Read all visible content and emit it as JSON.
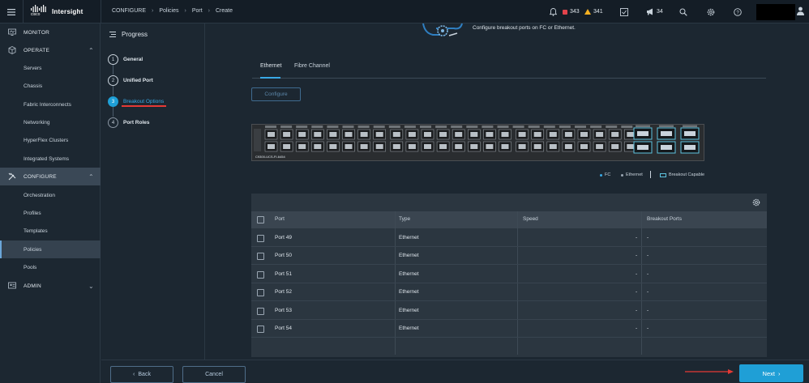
{
  "app": {
    "brand": "Intersight",
    "vendor": "cisco"
  },
  "breadcrumb": [
    "CONFIGURE",
    "Policies",
    "Port",
    "Create"
  ],
  "topbar": {
    "critical_count": "343",
    "warning_count": "341",
    "announcements_count": "34"
  },
  "sidebar": {
    "sections": [
      {
        "label": "MONITOR"
      },
      {
        "label": "OPERATE",
        "items": [
          "Servers",
          "Chassis",
          "Fabric Interconnects",
          "Networking",
          "HyperFlex Clusters",
          "Integrated Systems"
        ]
      },
      {
        "label": "CONFIGURE",
        "items": [
          "Orchestration",
          "Profiles",
          "Templates",
          "Policies",
          "Pools"
        ]
      },
      {
        "label": "ADMIN"
      }
    ],
    "active_item": "Policies"
  },
  "progress": {
    "title": "Progress",
    "steps": [
      {
        "num": "1",
        "label": "General"
      },
      {
        "num": "2",
        "label": "Unified Port"
      },
      {
        "num": "3",
        "label": "Breakout Options"
      },
      {
        "num": "4",
        "label": "Port Roles"
      }
    ],
    "active_step": 3
  },
  "main": {
    "description": "Configure breakout ports on FC or Ethernet.",
    "tabs": [
      "Ethernet",
      "Fibre Channel"
    ],
    "active_tab": "Ethernet",
    "configure_label": "Configure",
    "switch_model": "C9300-UCS-FI-6454",
    "legend": {
      "fc": "FC",
      "ethernet": "Ethernet",
      "breakout": "Breakout Capable"
    },
    "colors": {
      "fc": "#39a9e6",
      "ethernet": "#9aa6b2",
      "breakout": "#5ec4e0",
      "accent": "#1f9fd6"
    }
  },
  "table": {
    "columns": [
      "Port",
      "Type",
      "Speed",
      "Breakout Ports"
    ],
    "rows": [
      {
        "port": "Port 49",
        "type": "Ethernet",
        "speed": "-",
        "breakout": "-"
      },
      {
        "port": "Port 50",
        "type": "Ethernet",
        "speed": "-",
        "breakout": "-"
      },
      {
        "port": "Port 51",
        "type": "Ethernet",
        "speed": "-",
        "breakout": "-"
      },
      {
        "port": "Port 52",
        "type": "Ethernet",
        "speed": "-",
        "breakout": "-"
      },
      {
        "port": "Port 53",
        "type": "Ethernet",
        "speed": "-",
        "breakout": "-"
      },
      {
        "port": "Port 54",
        "type": "Ethernet",
        "speed": "-",
        "breakout": "-"
      }
    ]
  },
  "footer": {
    "back_label": "Back",
    "cancel_label": "Cancel",
    "next_label": "Next"
  }
}
